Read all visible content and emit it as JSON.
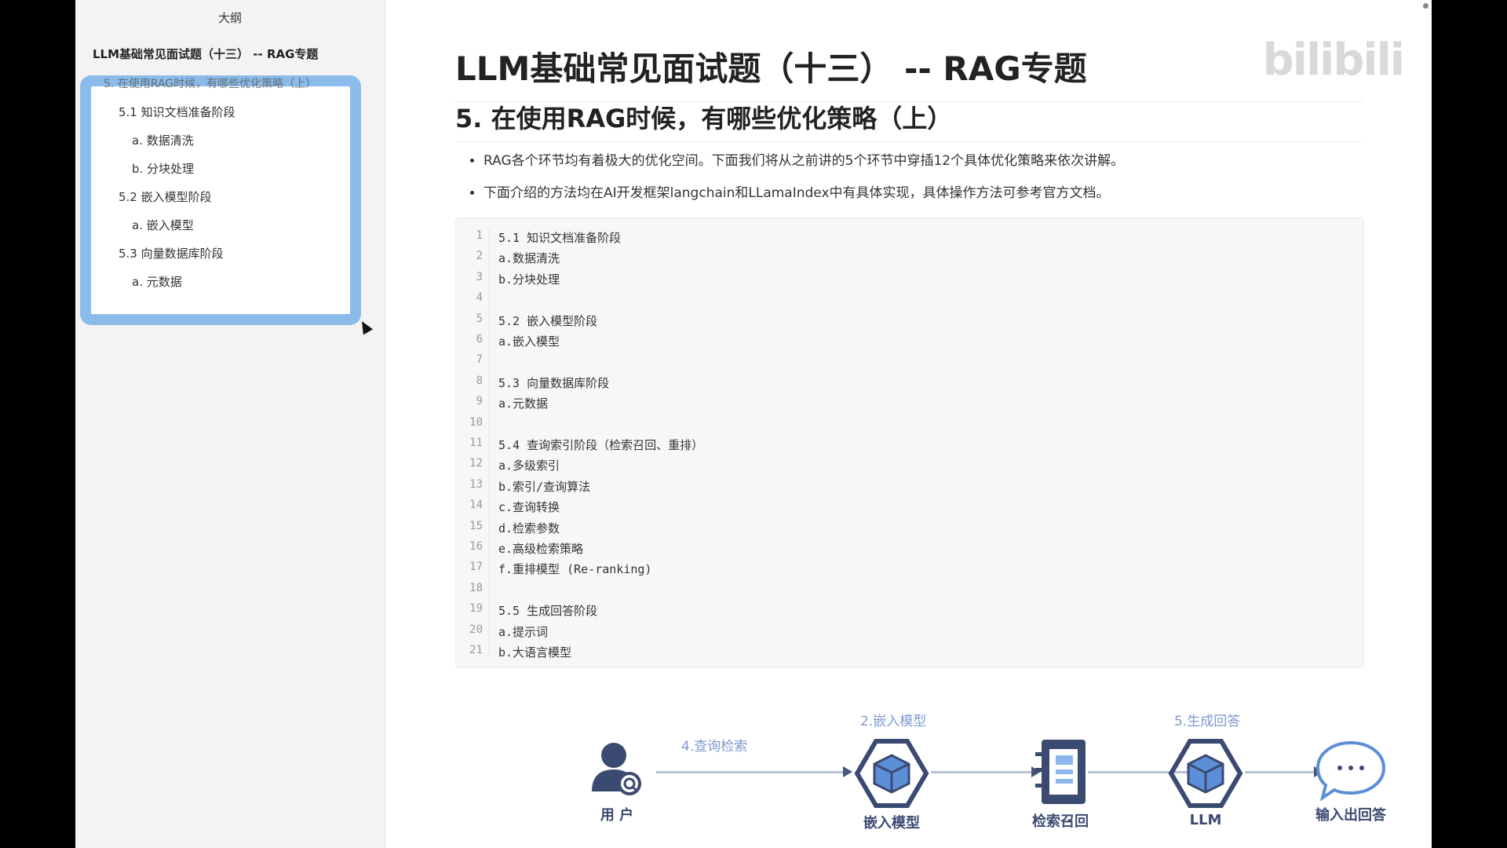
{
  "window": {
    "title": ""
  },
  "sidebar": {
    "title": "大纲",
    "h1": "LLM基础常见面试题（十三） -- RAG专题",
    "h2": "5. 在使用RAG时候，有哪些优化策略（上）",
    "items": [
      {
        "label": "5.1 知识文档准备阶段",
        "level": 3
      },
      {
        "label": "a. 数据清洗",
        "level": 4
      },
      {
        "label": "b. 分块处理",
        "level": 4
      },
      {
        "label": "5.2 嵌入模型阶段",
        "level": 3
      },
      {
        "label": "a. 嵌入模型",
        "level": 4
      },
      {
        "label": "5.3 向量数据库阶段",
        "level": 3
      },
      {
        "label": "a. 元数据",
        "level": 4
      }
    ]
  },
  "main": {
    "h1": "LLM基础常见面试题（十三） -- RAG专题",
    "h2": "5. 在使用RAG时候，有哪些优化策略（上）",
    "bullets": [
      "RAG各个环节均有着极大的优化空间。下面我们将从之前讲的5个环节中穿插12个具体优化策略来依次讲解。",
      "下面介绍的方法均在AI开发框架langchain和LLamaIndex中有具体实现，具体操作方法可参考官方文档。"
    ],
    "code_lines": [
      {
        "n": "1",
        "t": "5.1 知识文档准备阶段"
      },
      {
        "n": "2",
        "t": "a.数据清洗"
      },
      {
        "n": "3",
        "t": "b.分块处理"
      },
      {
        "n": "4",
        "t": ""
      },
      {
        "n": "5",
        "t": "5.2 嵌入模型阶段"
      },
      {
        "n": "6",
        "t": "a.嵌入模型"
      },
      {
        "n": "7",
        "t": ""
      },
      {
        "n": "8",
        "t": "5.3 向量数据库阶段"
      },
      {
        "n": "9",
        "t": "a.元数据"
      },
      {
        "n": "10",
        "t": ""
      },
      {
        "n": "11",
        "t": "5.4 查询索引阶段（检索召回、重排）"
      },
      {
        "n": "12",
        "t": "a.多级索引"
      },
      {
        "n": "13",
        "t": "b.索引/查询算法"
      },
      {
        "n": "14",
        "t": "c.查询转换"
      },
      {
        "n": "15",
        "t": "d.检索参数"
      },
      {
        "n": "16",
        "t": "e.高级检索策略"
      },
      {
        "n": "17",
        "t": "f.重排模型 (Re-ranking)"
      },
      {
        "n": "18",
        "t": ""
      },
      {
        "n": "19",
        "t": "5.5 生成回答阶段"
      },
      {
        "n": "20",
        "t": "a.提示词"
      },
      {
        "n": "21",
        "t": "b.大语言模型"
      }
    ]
  },
  "diagram": {
    "nodes": [
      {
        "name": "user",
        "label": "用 户",
        "icon": "user-search-icon"
      },
      {
        "name": "embedding",
        "label": "嵌入模型",
        "icon": "cube-hexagon-icon"
      },
      {
        "name": "retrieve",
        "label": "检索召回",
        "icon": "notebook-icon"
      },
      {
        "name": "llm",
        "label": "LLM",
        "icon": "cube-hexagon-icon"
      },
      {
        "name": "answer",
        "label": "输入出回答",
        "icon": "chat-bubble-icon"
      }
    ],
    "step_labels": {
      "query": "4.查询检索",
      "embed": "2.嵌入模型",
      "generate": "5.生成回答"
    },
    "colors": {
      "accent": "#3a4a70",
      "step": "#7f9bcc",
      "line": "#b7c0d4"
    }
  },
  "watermark": "bilibili"
}
